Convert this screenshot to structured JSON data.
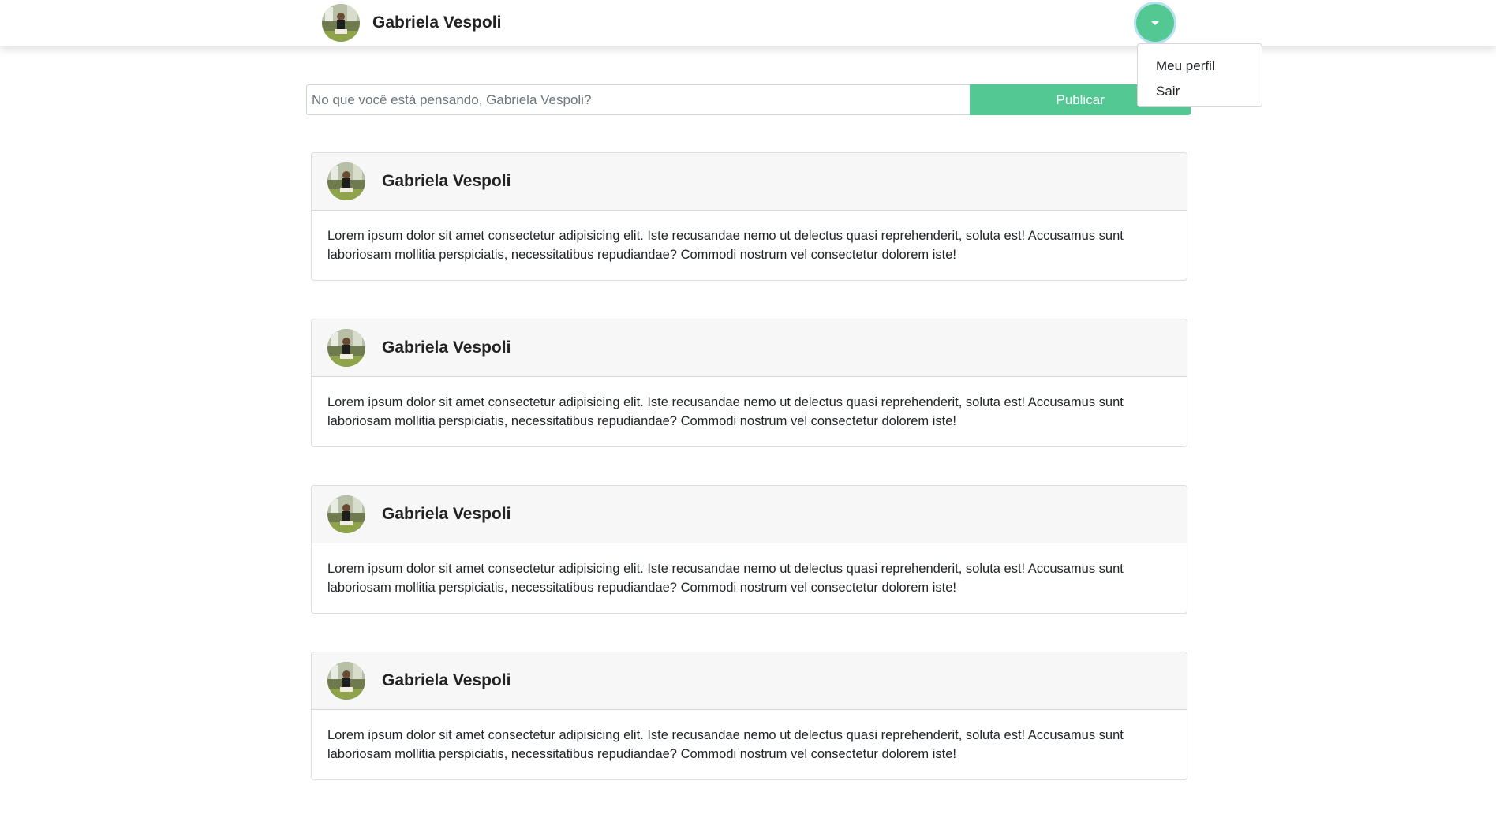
{
  "navbar": {
    "user_name": "Gabriela Vespoli",
    "avatar_icon": "user-photo-avatar",
    "dropdown_icon": "caret-down-icon",
    "accent_color": "#54c893"
  },
  "dropdown": {
    "items": [
      {
        "label": "Meu perfil"
      },
      {
        "label": "Sair"
      }
    ]
  },
  "composer": {
    "placeholder": "No que você está pensando, Gabriela Vespoli?",
    "value": "",
    "publish_label": "Publicar"
  },
  "posts": [
    {
      "author": "Gabriela Vespoli",
      "body": "Lorem ipsum dolor sit amet consectetur adipisicing elit. Iste recusandae nemo ut delectus quasi reprehenderit, soluta est! Accusamus sunt laboriosam mollitia perspiciatis, necessitatibus repudiandae? Commodi nostrum vel consectetur dolorem iste!"
    },
    {
      "author": "Gabriela Vespoli",
      "body": "Lorem ipsum dolor sit amet consectetur adipisicing elit. Iste recusandae nemo ut delectus quasi reprehenderit, soluta est! Accusamus sunt laboriosam mollitia perspiciatis, necessitatibus repudiandae? Commodi nostrum vel consectetur dolorem iste!"
    },
    {
      "author": "Gabriela Vespoli",
      "body": "Lorem ipsum dolor sit amet consectetur adipisicing elit. Iste recusandae nemo ut delectus quasi reprehenderit, soluta est! Accusamus sunt laboriosam mollitia perspiciatis, necessitatibus repudiandae? Commodi nostrum vel consectetur dolorem iste!"
    },
    {
      "author": "Gabriela Vespoli",
      "body": "Lorem ipsum dolor sit amet consectetur adipisicing elit. Iste recusandae nemo ut delectus quasi reprehenderit, soluta est! Accusamus sunt laboriosam mollitia perspiciatis, necessitatibus repudiandae? Commodi nostrum vel consectetur dolorem iste!"
    }
  ]
}
